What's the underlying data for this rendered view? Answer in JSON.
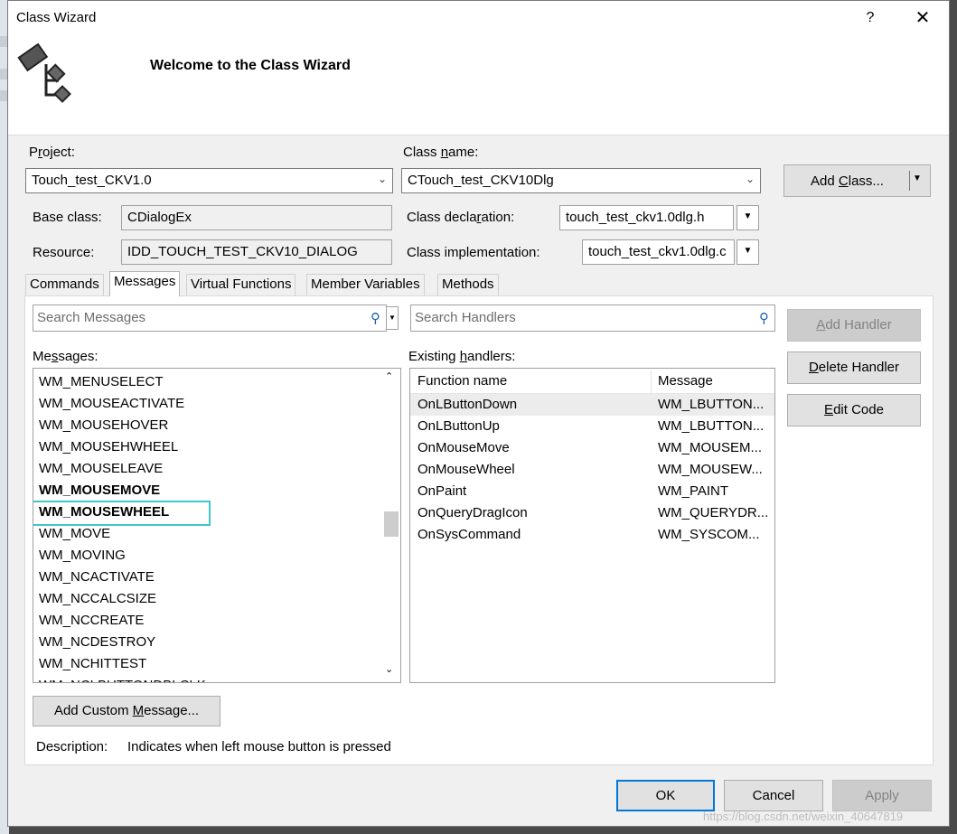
{
  "window": {
    "title": "Class Wizard",
    "help_label": "?",
    "close_label": "✕",
    "welcome": "Welcome to the Class Wizard"
  },
  "project": {
    "label_prefix": "P",
    "label_underlined": "r",
    "label_suffix": "oject:",
    "value": "Touch_test_CKV1.0"
  },
  "class_name": {
    "label_prefix": "Class ",
    "label_underlined": "n",
    "label_suffix": "ame:",
    "value": "CTouch_test_CKV10Dlg"
  },
  "add_class": {
    "label_prefix": "Add ",
    "label_underlined": "C",
    "label_suffix": "lass..."
  },
  "base_class": {
    "label": "Base class:",
    "value": "CDialogEx"
  },
  "resource": {
    "label": "Resource:",
    "value": "IDD_TOUCH_TEST_CKV10_DIALOG"
  },
  "class_declaration": {
    "label_prefix": "Class decla",
    "label_underlined": "r",
    "label_suffix": "ation:",
    "value": "touch_test_ckv1.0dlg.h"
  },
  "class_implementation": {
    "label": "Class implementation:",
    "value": "touch_test_ckv1.0dlg.c"
  },
  "tabs": [
    "Commands",
    "Messages",
    "Virtual Functions",
    "Member Variables",
    "Methods"
  ],
  "active_tab": "Messages",
  "search_messages_placeholder": "Search Messages",
  "search_handlers_placeholder": "Search Handlers",
  "messages_label": {
    "prefix": "Me",
    "underlined": "s",
    "suffix": "sages:"
  },
  "messages": [
    "WM_MENUSELECT",
    "WM_MOUSEACTIVATE",
    "WM_MOUSEHOVER",
    "WM_MOUSEHWHEEL",
    "WM_MOUSELEAVE",
    "WM_MOUSEMOVE",
    "WM_MOUSEWHEEL",
    "WM_MOVE",
    "WM_MOVING",
    "WM_NCACTIVATE",
    "WM_NCCALCSIZE",
    "WM_NCCREATE",
    "WM_NCDESTROY",
    "WM_NCHITTEST",
    "WM_NCLBUTTONDBLCLK"
  ],
  "bold_messages": [
    "WM_MOUSEMOVE",
    "WM_MOUSEWHEEL"
  ],
  "selected_message": "WM_MOUSEWHEEL",
  "handlers_label": {
    "prefix": "Existing ",
    "underlined": "h",
    "suffix": "andlers:"
  },
  "handlers_columns": [
    "Function name",
    "Message"
  ],
  "handlers": [
    {
      "function": "OnLButtonDown",
      "message": "WM_LBUTTON..."
    },
    {
      "function": "OnLButtonUp",
      "message": "WM_LBUTTON..."
    },
    {
      "function": "OnMouseMove",
      "message": "WM_MOUSEM..."
    },
    {
      "function": "OnMouseWheel",
      "message": "WM_MOUSEW..."
    },
    {
      "function": "OnPaint",
      "message": "WM_PAINT"
    },
    {
      "function": "OnQueryDragIcon",
      "message": "WM_QUERYDR..."
    },
    {
      "function": "OnSysCommand",
      "message": "WM_SYSCOM..."
    }
  ],
  "selected_handler": "OnLButtonDown",
  "add_handler": {
    "prefix": "",
    "underlined": "A",
    "suffix": "dd Handler"
  },
  "delete_handler": {
    "prefix": "",
    "underlined": "D",
    "suffix": "elete Handler"
  },
  "edit_code": {
    "prefix": "",
    "underlined": "E",
    "suffix": "dit Code"
  },
  "add_custom_message": {
    "prefix": "Add Custom ",
    "underlined": "M",
    "suffix": "essage..."
  },
  "description": {
    "label": "Description:",
    "value": "Indicates when left mouse button is pressed"
  },
  "footer": {
    "ok": "OK",
    "cancel": "Cancel",
    "apply": "Apply"
  },
  "watermark": "https://blog.csdn.net/weixin_40647819"
}
